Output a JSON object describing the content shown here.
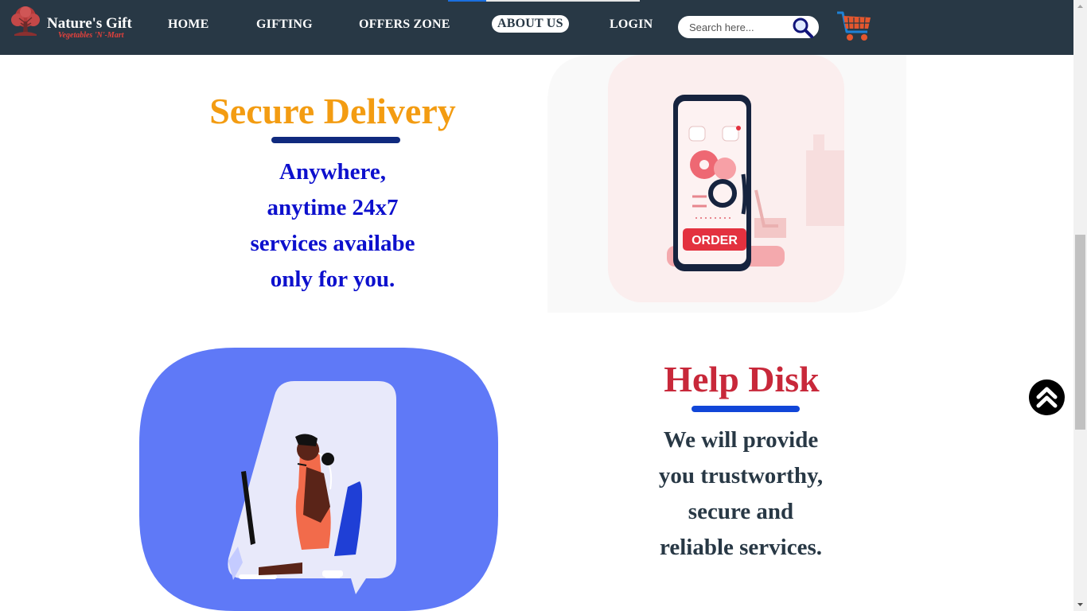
{
  "brand": {
    "name": "Nature's Gift",
    "tagline": "Vegetables 'N'-Mart",
    "logo_icon": "tree-icon"
  },
  "nav": {
    "items": [
      {
        "label": "HOME"
      },
      {
        "label": "GIFTING"
      },
      {
        "label": "OFFERS ZONE"
      },
      {
        "label": "ABOUT US",
        "active": true
      },
      {
        "label": "LOGIN"
      }
    ]
  },
  "search": {
    "placeholder": "Search here...",
    "value": "",
    "icon": "magnifier-icon"
  },
  "cart": {
    "icon": "shopping-cart-icon"
  },
  "sections": [
    {
      "title": "Secure Delivery",
      "lines": [
        "Anywhere,",
        "anytime 24x7",
        "services availabe",
        "only for you."
      ],
      "illustration": "phone-order-illustration",
      "illustration_text": "ORDER"
    },
    {
      "title": "Help Disk",
      "lines": [
        "We will provide",
        "you trustworthy,",
        "secure and",
        "reliable services."
      ],
      "illustration": "support-agent-illustration"
    }
  ],
  "scroll_top": {
    "icon": "double-chevron-up-icon"
  },
  "colors": {
    "navbar": "#283845",
    "secure_title": "#f39c12",
    "secure_text": "#0d10cd",
    "help_title": "#c8283a",
    "help_text": "#283845",
    "help_blob": "#5f79f7"
  }
}
